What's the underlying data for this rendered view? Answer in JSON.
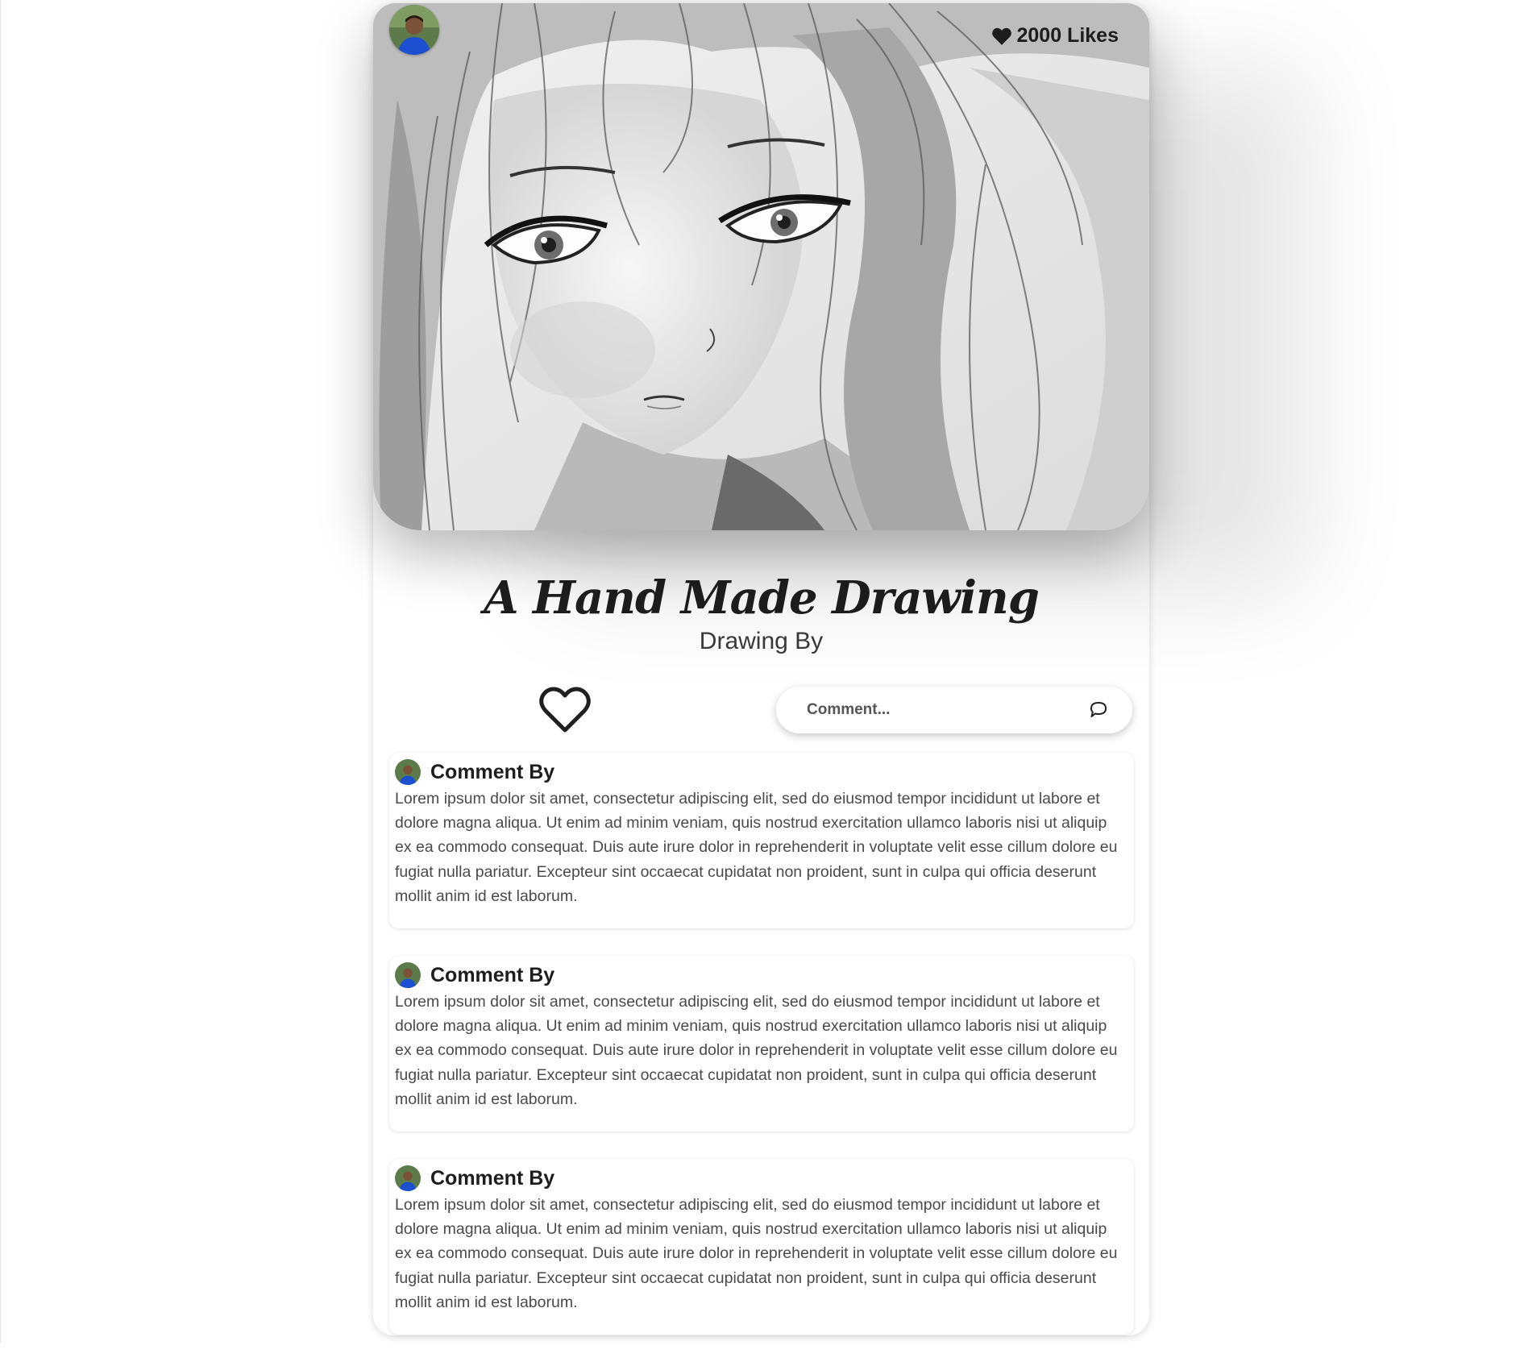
{
  "post": {
    "likes_label": "2000 Likes",
    "title": "A Hand Made Drawing",
    "subtitle": "Drawing By",
    "comment_placeholder": "Comment..."
  },
  "icons": {
    "likes": "heart-filled-icon",
    "like_button": "heart-outline-icon",
    "send": "speech-bubble-icon"
  },
  "comments": [
    {
      "author": "Comment By",
      "text": "Lorem ipsum dolor sit amet, consectetur adipiscing elit, sed do eiusmod tempor incididunt ut labore et dolore magna aliqua. Ut enim ad minim veniam, quis nostrud exercitation ullamco laboris nisi ut aliquip ex ea commodo consequat. Duis aute irure dolor in reprehenderit in voluptate velit esse cillum dolore eu fugiat nulla pariatur. Excepteur sint occaecat cupidatat non proident, sunt in culpa qui officia deserunt mollit anim id est laborum."
    },
    {
      "author": "Comment By",
      "text": "Lorem ipsum dolor sit amet, consectetur adipiscing elit, sed do eiusmod tempor incididunt ut labore et dolore magna aliqua. Ut enim ad minim veniam, quis nostrud exercitation ullamco laboris nisi ut aliquip ex ea commodo consequat. Duis aute irure dolor in reprehenderit in voluptate velit esse cillum dolore eu fugiat nulla pariatur. Excepteur sint occaecat cupidatat non proident, sunt in culpa qui officia deserunt mollit anim id est laborum."
    },
    {
      "author": "Comment By",
      "text": "Lorem ipsum dolor sit amet, consectetur adipiscing elit, sed do eiusmod tempor incididunt ut labore et dolore magna aliqua. Ut enim ad minim veniam, quis nostrud exercitation ullamco laboris nisi ut aliquip ex ea commodo consequat. Duis aute irure dolor in reprehenderit in voluptate velit esse cillum dolore eu fugiat nulla pariatur. Excepteur sint occaecat cupidatat non proident, sunt in culpa qui officia deserunt mollit anim id est laborum."
    }
  ]
}
